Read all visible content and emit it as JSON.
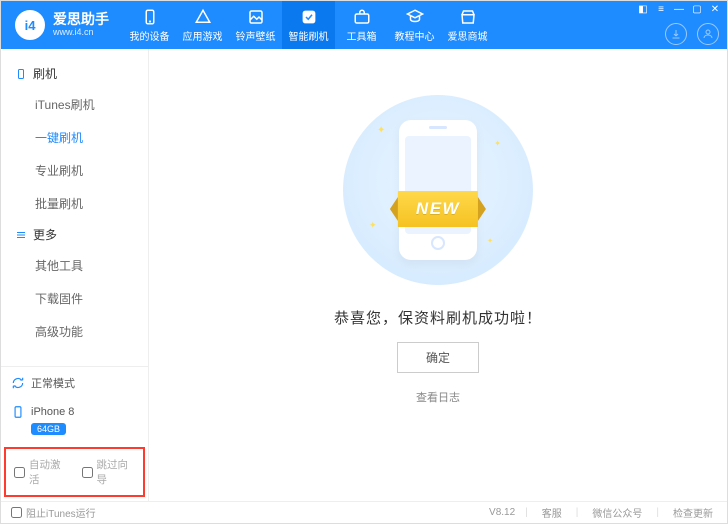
{
  "brand": {
    "name": "爱思助手",
    "url": "www.i4.cn",
    "logo_letters": "i4"
  },
  "nav": {
    "items": [
      {
        "id": "devices",
        "label": "我的设备"
      },
      {
        "id": "apps",
        "label": "应用游戏"
      },
      {
        "id": "ringwall",
        "label": "铃声壁纸"
      },
      {
        "id": "flash",
        "label": "智能刷机",
        "active": true
      },
      {
        "id": "toolbox",
        "label": "工具箱"
      },
      {
        "id": "tutorial",
        "label": "教程中心"
      },
      {
        "id": "store",
        "label": "爱思商城"
      }
    ]
  },
  "sidebar": {
    "group1": {
      "title": "刷机",
      "items": [
        {
          "id": "itunes-flash",
          "label": "iTunes刷机"
        },
        {
          "id": "onekey-flash",
          "label": "一键刷机",
          "active": true
        },
        {
          "id": "pro-flash",
          "label": "专业刷机"
        },
        {
          "id": "batch-flash",
          "label": "批量刷机"
        }
      ]
    },
    "group2": {
      "title": "更多",
      "items": [
        {
          "id": "other-tools",
          "label": "其他工具"
        },
        {
          "id": "download-fw",
          "label": "下载固件"
        },
        {
          "id": "advanced",
          "label": "高级功能"
        }
      ]
    },
    "mode_label": "正常模式",
    "device_name": "iPhone 8",
    "storage_badge": "64GB",
    "options": {
      "auto_activate": "自动激活",
      "skip_guide": "跳过向导"
    }
  },
  "main": {
    "ribbon_text": "NEW",
    "success_msg": "恭喜您，保资料刷机成功啦！",
    "ok_label": "确定",
    "view_log": "查看日志"
  },
  "footer": {
    "block_itunes": "阻止iTunes运行",
    "version": "V8.12",
    "links": {
      "service": "客服",
      "wechat": "微信公众号",
      "update": "检查更新"
    }
  }
}
